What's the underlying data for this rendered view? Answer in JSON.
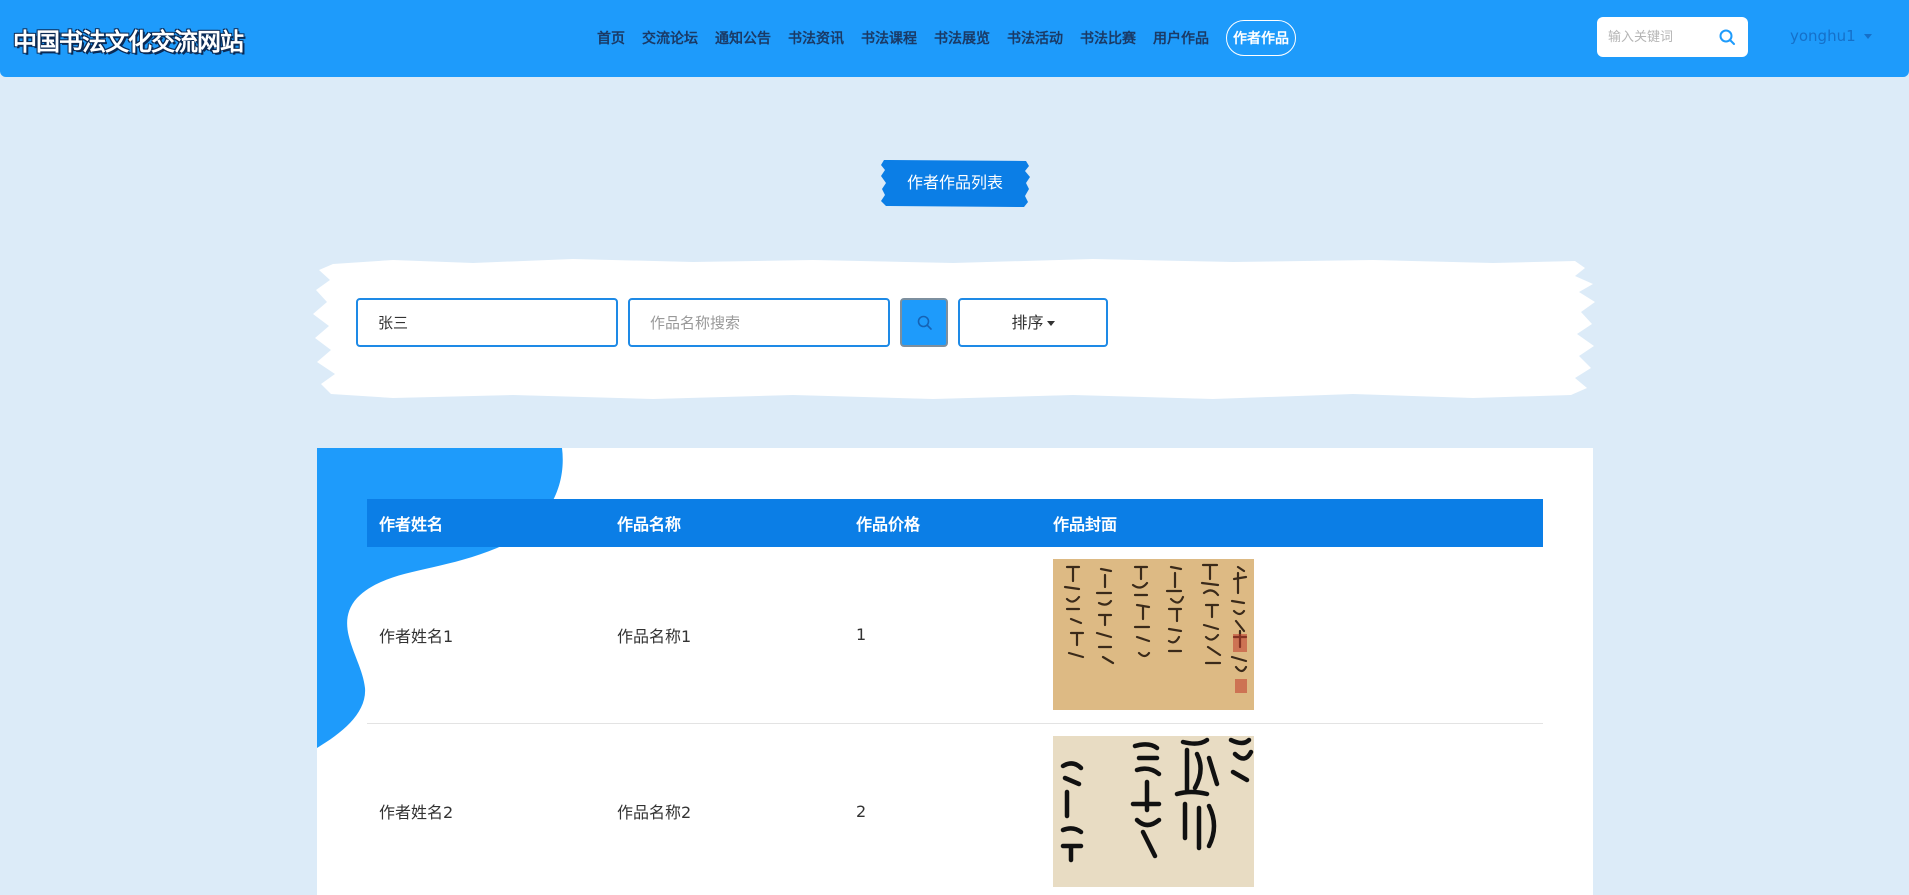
{
  "header": {
    "site_title": "中国书法文化交流网站",
    "nav": [
      {
        "label": "首页",
        "active": false
      },
      {
        "label": "交流论坛",
        "active": false
      },
      {
        "label": "通知公告",
        "active": false
      },
      {
        "label": "书法资讯",
        "active": false
      },
      {
        "label": "书法课程",
        "active": false
      },
      {
        "label": "书法展览",
        "active": false
      },
      {
        "label": "书法活动",
        "active": false
      },
      {
        "label": "书法比赛",
        "active": false
      },
      {
        "label": "用户作品",
        "active": false
      },
      {
        "label": "作者作品",
        "active": true
      }
    ],
    "search": {
      "placeholder": "输入关键词",
      "value": "",
      "icon": "search-icon"
    },
    "user": {
      "name": "yonghu1",
      "icon": "chevron-down-icon"
    }
  },
  "page": {
    "title": "作者作品列表"
  },
  "filters": {
    "author_name": {
      "value": "张三",
      "placeholder": ""
    },
    "work_name": {
      "value": "",
      "placeholder": "作品名称搜索"
    },
    "search_icon": "search-icon",
    "sort_label": "排序"
  },
  "table": {
    "columns": [
      "作者姓名",
      "作品名称",
      "作品价格",
      "作品封面"
    ],
    "rows": [
      {
        "author": "作者姓名1",
        "work": "作品名称1",
        "price": "1",
        "cover": "calligraphy-image"
      },
      {
        "author": "作者姓名2",
        "work": "作品名称2",
        "price": "2",
        "cover": "calligraphy-image"
      }
    ]
  },
  "colors": {
    "header_bg": "#1e9bfb",
    "page_bg": "#dcebf8",
    "accent": "#0b7ee6",
    "field_border": "#1e8ae6"
  }
}
